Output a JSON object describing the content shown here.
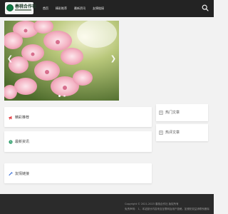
{
  "header": {
    "logo_text": "春桃合作社",
    "nav": [
      {
        "label": "首页",
        "active": true
      },
      {
        "label": "精彩推荐",
        "active": false
      },
      {
        "label": "最新资讯",
        "active": false
      },
      {
        "label": "友情链接",
        "active": false
      }
    ]
  },
  "slider": {
    "dots": 2,
    "active_dot": 0
  },
  "sections": {
    "recommend": "精彩推荐",
    "latest": "最新资讯",
    "links": "友情链接"
  },
  "sidebar": {
    "hot_articles": "热门文章",
    "popular_articles": "热评文章"
  },
  "footer": {
    "copyright": "Copyright © 2021-2023 春桃合作社 版权所有",
    "disclaimer": "免责声明：    1、本站部分内容来自互联网及用户投稿，如侵犯权益请联系删除"
  },
  "colors": {
    "header_bg": "#232323",
    "page_bg": "#f2f2f2",
    "footer_bg": "#2b2b2b",
    "accent_red": "#e5484d",
    "accent_green": "#2f9e6b"
  }
}
